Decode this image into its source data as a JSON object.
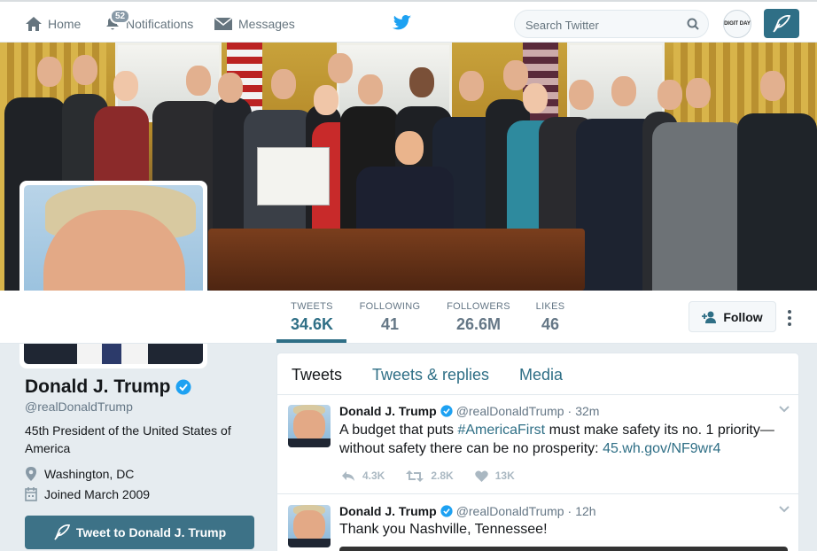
{
  "nav": {
    "home_label": "Home",
    "notifications_label": "Notifications",
    "notifications_count": "52",
    "messages_label": "Messages",
    "search_placeholder": "Search Twitter",
    "account_avatar_text": "DIGIT DAY"
  },
  "profile": {
    "name": "Donald J. Trump",
    "handle": "@realDonaldTrump",
    "bio": "45th President of the United States of America",
    "location": "Washington, DC",
    "joined": "Joined March 2009",
    "tweet_to_label": "Tweet to Donald J. Trump"
  },
  "stats": [
    {
      "label": "TWEETS",
      "value": "34.6K"
    },
    {
      "label": "FOLLOWING",
      "value": "41"
    },
    {
      "label": "FOLLOWERS",
      "value": "26.6M"
    },
    {
      "label": "LIKES",
      "value": "46"
    }
  ],
  "follow_label": "Follow",
  "timeline": {
    "tabs": [
      "Tweets",
      "Tweets & replies",
      "Media"
    ],
    "tweets": [
      {
        "name": "Donald J. Trump",
        "handle": "@realDonaldTrump",
        "time": "32m",
        "text_prefix": "A budget that puts ",
        "hashtag": "#AmericaFirst",
        "text_middle": " must make safety its no. 1 priority—without safety there can be no prosperity: ",
        "link": "45.wh.gov/NF9wr4",
        "replies": "4.3K",
        "retweets": "2.8K",
        "likes": "13K"
      },
      {
        "name": "Donald J. Trump",
        "handle": "@realDonaldTrump",
        "time": "12h",
        "text": "Thank you Nashville, Tennessee!"
      }
    ]
  },
  "colors": {
    "accent": "#2f6f86",
    "verified": "#1da1f2",
    "muted": "#657786"
  }
}
